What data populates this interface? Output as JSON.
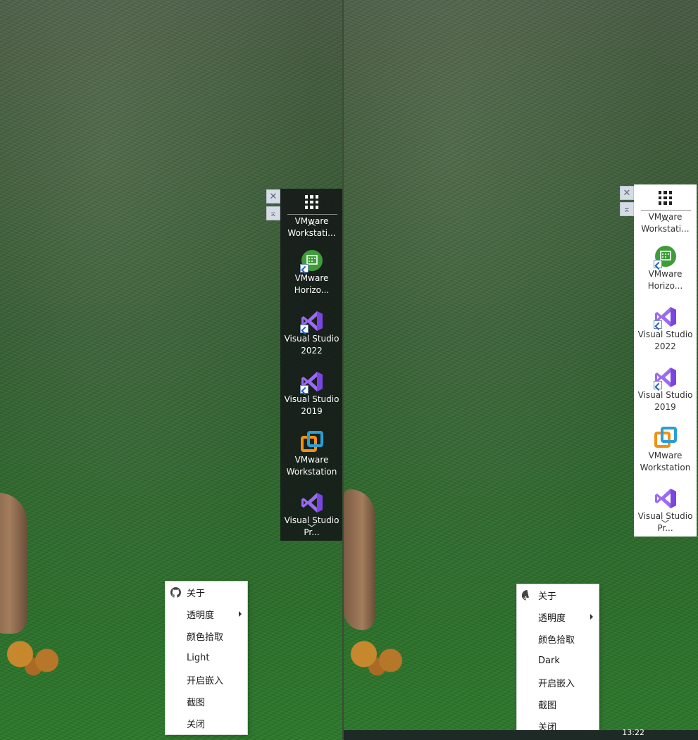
{
  "left": {
    "theme": "dark",
    "dock_items": [
      {
        "label": "VMware Workstati...",
        "icon": "vmware-workstation-icon"
      },
      {
        "label": "VMware Horizo...",
        "icon": "vmware-horizon-icon"
      },
      {
        "label": "Visual Studio 2022",
        "icon": "visual-studio-icon"
      },
      {
        "label": "Visual Studio 2019",
        "icon": "visual-studio-icon"
      },
      {
        "label": "VMware Workstation",
        "icon": "vmware-workstation-icon"
      },
      {
        "label": "Visual Studio Pr...",
        "icon": "visual-studio-icon"
      }
    ],
    "menu": {
      "items": [
        {
          "label": "关于",
          "icon": "github-icon"
        },
        {
          "label": "透明度",
          "submenu": true
        },
        {
          "label": "颜色拾取"
        },
        {
          "label": "Light"
        },
        {
          "label": "开启嵌入"
        },
        {
          "label": "截图"
        },
        {
          "label": "关闭"
        }
      ]
    }
  },
  "right": {
    "theme": "light",
    "dock_items": [
      {
        "label": "VMware Workstati...",
        "icon": "vmware-workstation-icon"
      },
      {
        "label": "VMware Horizo...",
        "icon": "vmware-horizon-icon"
      },
      {
        "label": "Visual Studio 2022",
        "icon": "visual-studio-icon"
      },
      {
        "label": "Visual Studio 2019",
        "icon": "visual-studio-icon"
      },
      {
        "label": "VMware Workstation",
        "icon": "vmware-workstation-icon"
      },
      {
        "label": "Visual Studio Pr...",
        "icon": "visual-studio-icon"
      }
    ],
    "menu": {
      "items": [
        {
          "label": "关于",
          "icon": "github-icon"
        },
        {
          "label": "透明度",
          "submenu": true
        },
        {
          "label": "颜色拾取"
        },
        {
          "label": "Dark"
        },
        {
          "label": "开启嵌入"
        },
        {
          "label": "截图"
        },
        {
          "label": "关闭"
        }
      ]
    },
    "clock": "13:22"
  },
  "colors": {
    "vs_purple": "#8b5cf6",
    "vmware_orange": "#f29111",
    "vmware_blue": "#2a9fd6",
    "horizon_green": "#3f9c3a"
  }
}
